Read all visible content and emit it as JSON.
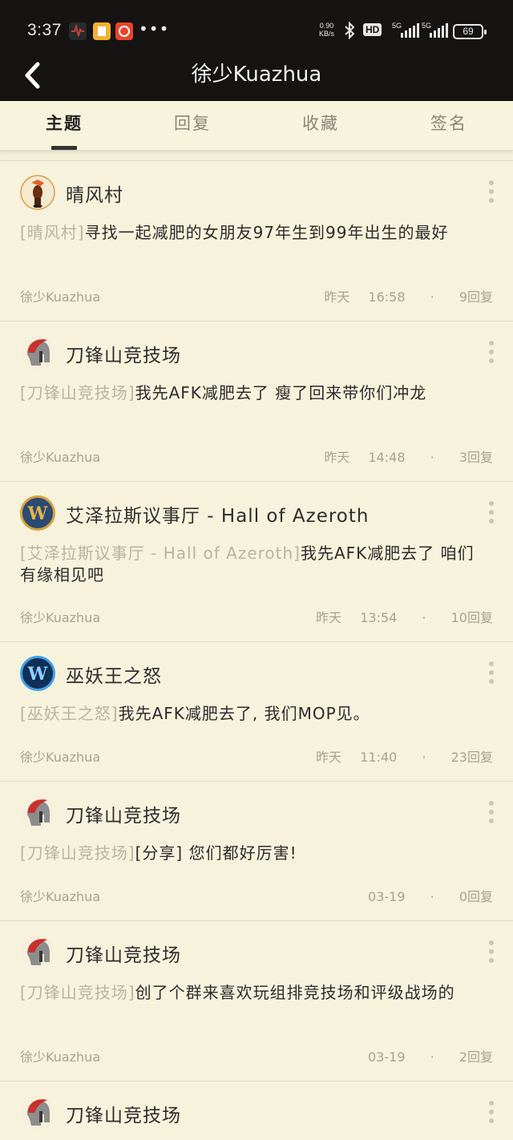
{
  "status_bar": {
    "time": "3:37",
    "speed_value": "0.90",
    "speed_unit": "KB/s",
    "hd_label": "HD",
    "net1": "5G",
    "net2": "5G",
    "battery": "69"
  },
  "header": {
    "title": "徐少Kuazhua"
  },
  "tabs": [
    {
      "label": "主题",
      "active": true
    },
    {
      "label": "回复",
      "active": false
    },
    {
      "label": "收藏",
      "active": false
    },
    {
      "label": "签名",
      "active": false
    }
  ],
  "posts": [
    {
      "board": "晴风村",
      "tag": "[晴风村]",
      "text": "寻找一起减肥的女朋友97年生到99年出生的最好",
      "author": "徐少Kuazhua",
      "date": "昨天",
      "time": "16:58",
      "dot": "·",
      "replies": "9回复",
      "avatar": "bird-avatar"
    },
    {
      "board": "刀锋山竞技场",
      "tag": "[刀锋山竞技场]",
      "text": "我先AFK减肥去了  瘦了回来带你们冲龙",
      "author": "徐少Kuazhua",
      "date": "昨天",
      "time": "14:48",
      "dot": "·",
      "replies": "3回复",
      "avatar": "spartan-helmet-avatar"
    },
    {
      "board": "艾泽拉斯议事厅 - Hall of Azeroth",
      "tag": "[艾泽拉斯议事厅 - Hall of Azeroth]",
      "text": "我先AFK减肥去了  咱们有缘相见吧",
      "author": "徐少Kuazhua",
      "date": "昨天",
      "time": "13:54",
      "dot": "·",
      "replies": "10回复",
      "avatar": "wow-gold-avatar"
    },
    {
      "board": "巫妖王之怒",
      "tag": "[巫妖王之怒]",
      "text": "我先AFK减肥去了, 我们MOP见。",
      "author": "徐少Kuazhua",
      "date": "昨天",
      "time": "11:40",
      "dot": "·",
      "replies": "23回复",
      "avatar": "wow-blue-avatar"
    },
    {
      "board": "刀锋山竞技场",
      "tag": "[刀锋山竞技场]",
      "text": "[分享] 您们都好厉害!",
      "author": "徐少Kuazhua",
      "date": "",
      "time": "03-19",
      "dot": "·",
      "replies": "0回复",
      "avatar": "spartan-helmet-avatar"
    },
    {
      "board": "刀锋山竞技场",
      "tag": "[刀锋山竞技场]",
      "text": "创了个群来喜欢玩组排竞技场和评级战场的",
      "author": "徐少Kuazhua",
      "date": "",
      "time": "03-19",
      "dot": "·",
      "replies": "2回复",
      "avatar": "spartan-helmet-avatar"
    },
    {
      "board": "刀锋山竞技场",
      "tag": "",
      "text": "",
      "author": "",
      "date": "",
      "time": "",
      "dot": "",
      "replies": "",
      "avatar": "spartan-helmet-avatar"
    }
  ]
}
